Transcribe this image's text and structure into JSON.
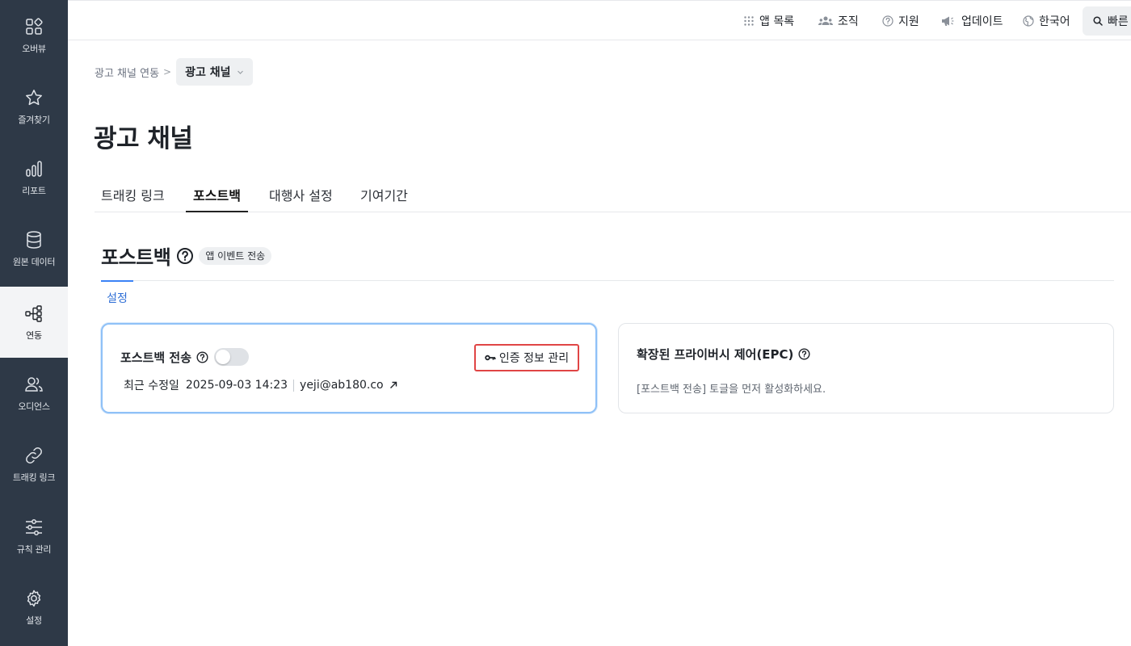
{
  "sidebar": {
    "items": [
      {
        "label": "오버뷰",
        "icon": "grid-icon"
      },
      {
        "label": "즐겨찾기",
        "icon": "star-icon"
      },
      {
        "label": "리포트",
        "icon": "bar-chart-icon"
      },
      {
        "label": "원본 데이터",
        "icon": "database-icon"
      },
      {
        "label": "연동",
        "icon": "integration-icon",
        "active": true
      },
      {
        "label": "오디언스",
        "icon": "users-icon"
      },
      {
        "label": "트래킹 링크",
        "icon": "link-icon"
      },
      {
        "label": "규칙 관리",
        "icon": "sliders-icon"
      },
      {
        "label": "설정",
        "icon": "gear-icon"
      }
    ]
  },
  "topbar": {
    "app_list": "앱 목록",
    "org": "조직",
    "support": "지원",
    "updates": "업데이트",
    "language": "한국어",
    "search": "빠른"
  },
  "breadcrumb": {
    "parent": "광고 채널 연동",
    "current": "광고 채널"
  },
  "page": {
    "title": "광고 채널"
  },
  "tabs": [
    "트래킹 링크",
    "포스트백",
    "대행사 설정",
    "기여기간"
  ],
  "active_tab": "포스트백",
  "section": {
    "title": "포스트백",
    "chip": "앱 이벤트 전송",
    "subtab": "설정"
  },
  "postback_card": {
    "label": "포스트백 전송",
    "toggle_on": false,
    "credentials_button": "인증 정보 관리",
    "modified_label": "최근 수정일",
    "modified_at": "2025-09-03 14:23",
    "modified_by": "yeji@ab180.co"
  },
  "epc_card": {
    "title": "확장된 프라이버시 제어(EPC)",
    "message": "[포스트백 전송] 토글을 먼저 활성화하세요."
  },
  "colors": {
    "sidebar_bg": "#2e3947",
    "accent_blue": "#3b82f6",
    "highlight_red": "#e04545"
  }
}
